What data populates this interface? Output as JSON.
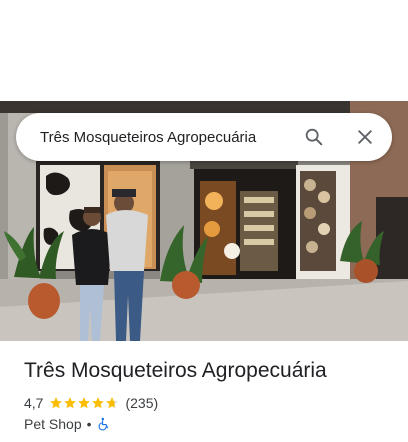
{
  "search": {
    "value": "Três Mosqueteiros Agropecuária",
    "search_icon": "search-icon",
    "close_icon": "close-icon"
  },
  "place": {
    "name": "Três Mosqueteiros Agropecuária",
    "rating": "4,7",
    "rating_fraction": 0.94,
    "star_color": "#fbbc04",
    "review_count": "(235)",
    "category": "Pet Shop",
    "separator": "•",
    "accessibility_icon": "wheelchair-icon",
    "accessibility_color": "#1a73e8"
  },
  "photo": {
    "subject_icon": "storefront-photo"
  }
}
